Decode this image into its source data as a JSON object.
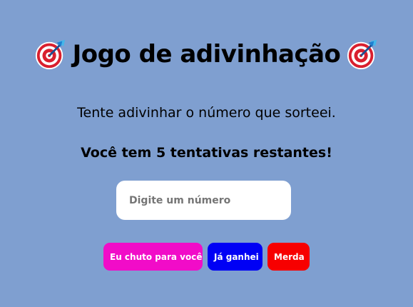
{
  "header": {
    "title": "Jogo de adivinhação",
    "left_icon": "target-dart-icon",
    "right_icon": "target-dart-icon"
  },
  "main": {
    "subtitle": "Tente adivinhar o número que sorteei.",
    "attempts_message": "Você tem 5 tentativas restantes!",
    "guess_input": {
      "value": "",
      "placeholder": "Digite um número"
    }
  },
  "actions": {
    "guess_label": "Eu chuto para você",
    "won_label": "Já ganhei",
    "quit_label": "Merda"
  },
  "colors": {
    "background": "#7f9fd0",
    "guess_button": "#f10cc8",
    "won_button": "#0000f5",
    "quit_button": "#f70000"
  }
}
